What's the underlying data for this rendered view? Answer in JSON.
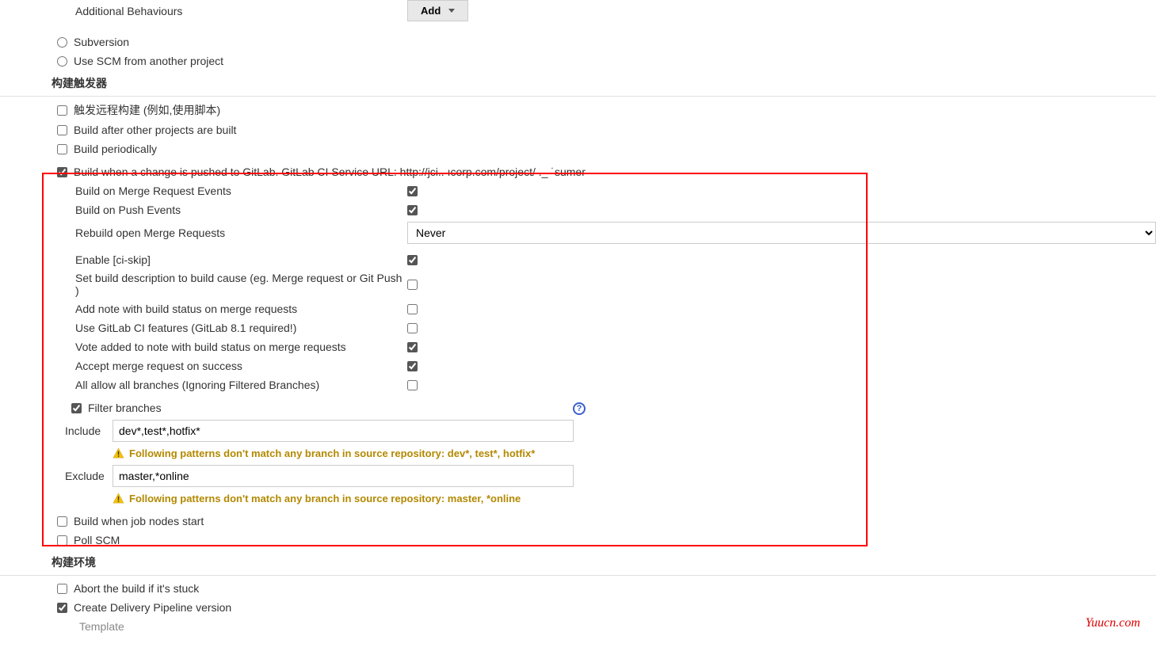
{
  "behaviours": {
    "label": "Additional Behaviours",
    "add_button": "Add"
  },
  "scm": {
    "subversion": "Subversion",
    "use_scm_other": "Use SCM from another project"
  },
  "sections": {
    "build_triggers": "构建触发器",
    "build_environment": "构建环境"
  },
  "triggers": {
    "remote": "触发远程构建 (例如,使用脚本)",
    "after_projects": "Build after other projects are built",
    "periodically": "Build periodically",
    "gitlab_push": "Build when a change is pushed to GitLab. GitLab CI Service URL: http://jci..      ıcorp.com/project/ ._                                         ˙sumer",
    "job_nodes_start": "Build when job nodes start",
    "poll_scm": "Poll SCM"
  },
  "gitlab": {
    "build_on_mr": "Build on Merge Request Events",
    "build_on_push": "Build on Push Events",
    "rebuild_open_mr": "Rebuild open Merge Requests",
    "rebuild_value": "Never",
    "ci_skip": "Enable [ci-skip]",
    "set_description": "Set build description to build cause (eg. Merge request or Git Push )",
    "add_note": "Add note with build status on merge requests",
    "use_ci_features": "Use GitLab CI features (GitLab 8.1 required!)",
    "vote_added": "Vote added to note with build status on merge requests",
    "accept_mr": "Accept merge request on success",
    "allow_all_branches": "All allow all branches (Ignoring Filtered Branches)",
    "filter_branches": "Filter branches",
    "include_label": "Include",
    "include_value": "dev*,test*,hotfix*",
    "include_warning": "Following patterns don't match any branch in source repository: dev*, test*, hotfix*",
    "exclude_label": "Exclude",
    "exclude_value": "master,*online",
    "exclude_warning": "Following patterns don't match any branch in source repository: master, *online"
  },
  "env": {
    "abort_stuck": "Abort the build if it's stuck",
    "create_pipeline": "Create Delivery Pipeline version",
    "template": "Template"
  },
  "watermark": "Yuucn.com",
  "help_glyph": "?"
}
